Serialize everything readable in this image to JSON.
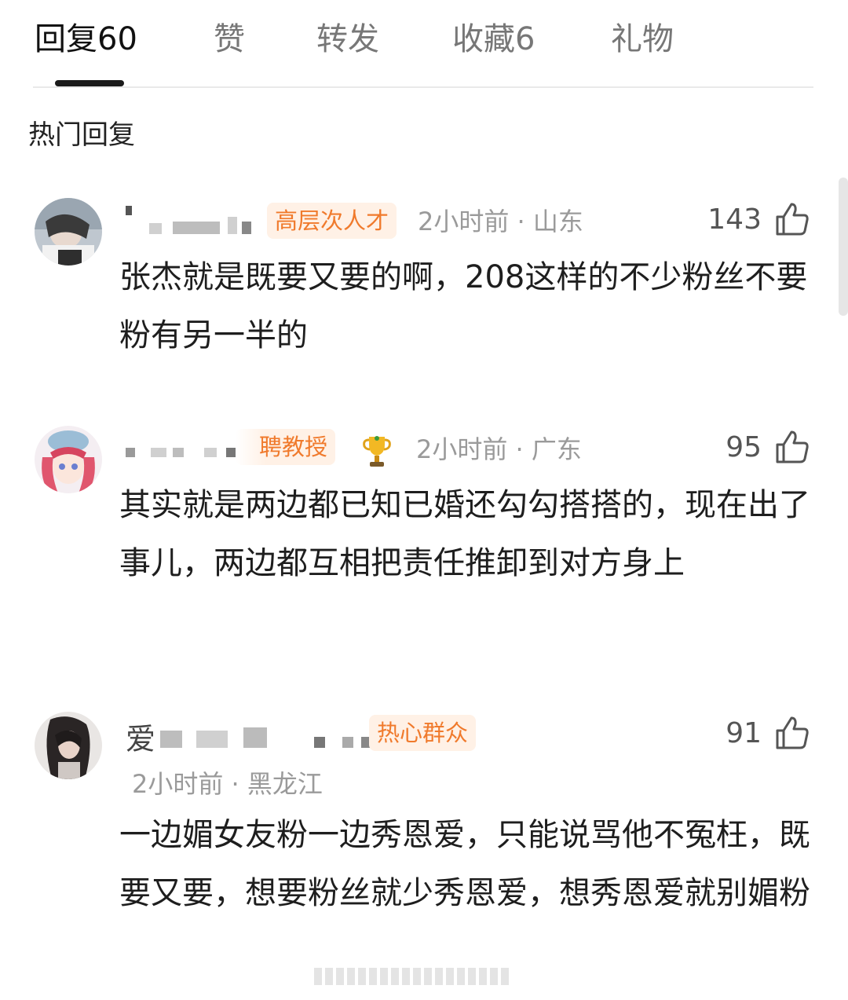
{
  "tabs": [
    {
      "label": "回复",
      "count": "60"
    },
    {
      "label": "赞",
      "count": ""
    },
    {
      "label": "转发",
      "count": ""
    },
    {
      "label": "收藏",
      "count": "6"
    },
    {
      "label": "礼物",
      "count": ""
    }
  ],
  "section_title": "热门回复",
  "comments": [
    {
      "badge": "高层次人才",
      "meta": "2小时前 · 山东",
      "likes": "143",
      "text": "张杰就是既要又要的啊，208这样的不少粉丝不要粉有另一半的"
    },
    {
      "badge": "聘教授",
      "meta": "2小时前 · 广东",
      "likes": "95",
      "text": "其实就是两边都已知已婚还勾勾搭搭的，现在出了事儿，两边都互相把责任推卸到对方身上"
    },
    {
      "name_visible": "爱",
      "badge": "热心群众",
      "meta": "2小时前 · 黑龙江",
      "likes": "91",
      "text": "一边媚女友粉一边秀恩爱，只能说骂他不冤枉，既要又要，想要粉丝就少秀恩爱，想秀恩爱就别媚粉"
    }
  ],
  "icons": {
    "like": "thumbs-up-icon",
    "trophy": "trophy-icon"
  },
  "colors": {
    "badge_bg": "#fff1e6",
    "badge_text": "#f07a2c",
    "meta": "#9a9a9a"
  }
}
